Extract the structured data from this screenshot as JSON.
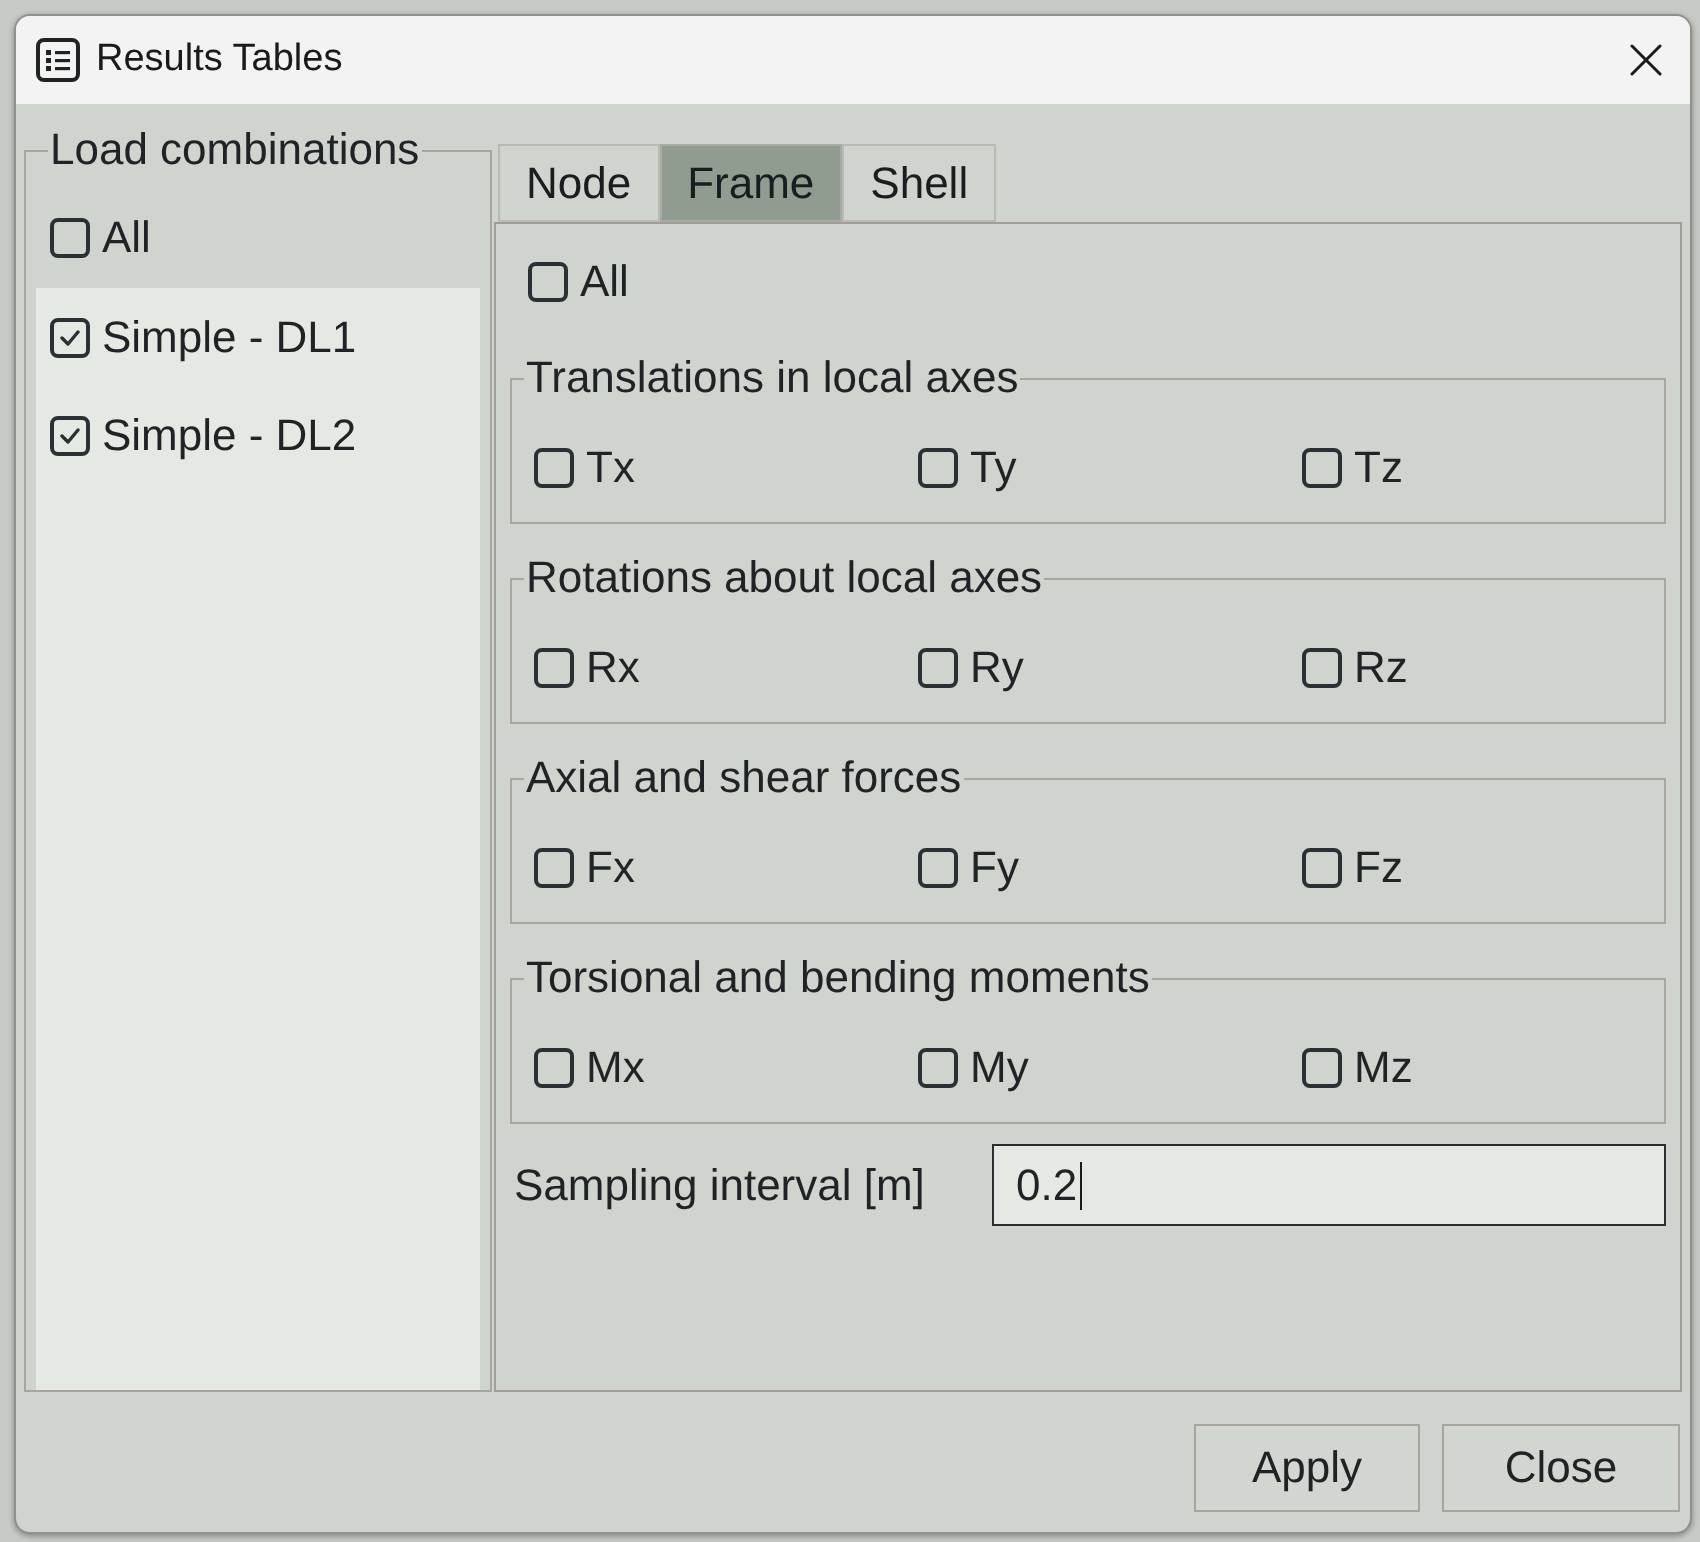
{
  "window": {
    "title": "Results Tables"
  },
  "load_combinations": {
    "title": "Load combinations",
    "all": {
      "label": "All",
      "checked": false
    },
    "items": [
      {
        "label": "Simple - DL1",
        "checked": true
      },
      {
        "label": "Simple - DL2",
        "checked": true
      }
    ]
  },
  "tabs": [
    {
      "label": "Node",
      "selected": false
    },
    {
      "label": "Frame",
      "selected": true
    },
    {
      "label": "Shell",
      "selected": false
    }
  ],
  "frame_tab": {
    "all": {
      "label": "All",
      "checked": false
    },
    "groups": [
      {
        "title": "Translations in local axes",
        "options": [
          {
            "label": "Tx",
            "checked": false
          },
          {
            "label": "Ty",
            "checked": false
          },
          {
            "label": "Tz",
            "checked": false
          }
        ]
      },
      {
        "title": "Rotations about local axes",
        "options": [
          {
            "label": "Rx",
            "checked": false
          },
          {
            "label": "Ry",
            "checked": false
          },
          {
            "label": "Rz",
            "checked": false
          }
        ]
      },
      {
        "title": "Axial and shear forces",
        "options": [
          {
            "label": "Fx",
            "checked": false
          },
          {
            "label": "Fy",
            "checked": false
          },
          {
            "label": "Fz",
            "checked": false
          }
        ]
      },
      {
        "title": "Torsional and bending moments",
        "options": [
          {
            "label": "Mx",
            "checked": false
          },
          {
            "label": "My",
            "checked": false
          },
          {
            "label": "Mz",
            "checked": false
          }
        ]
      }
    ],
    "sampling_interval": {
      "label": "Sampling interval [m]",
      "value": "0.2",
      "focused": true
    }
  },
  "buttons": [
    {
      "label": "Apply"
    },
    {
      "label": "Close"
    }
  ]
}
